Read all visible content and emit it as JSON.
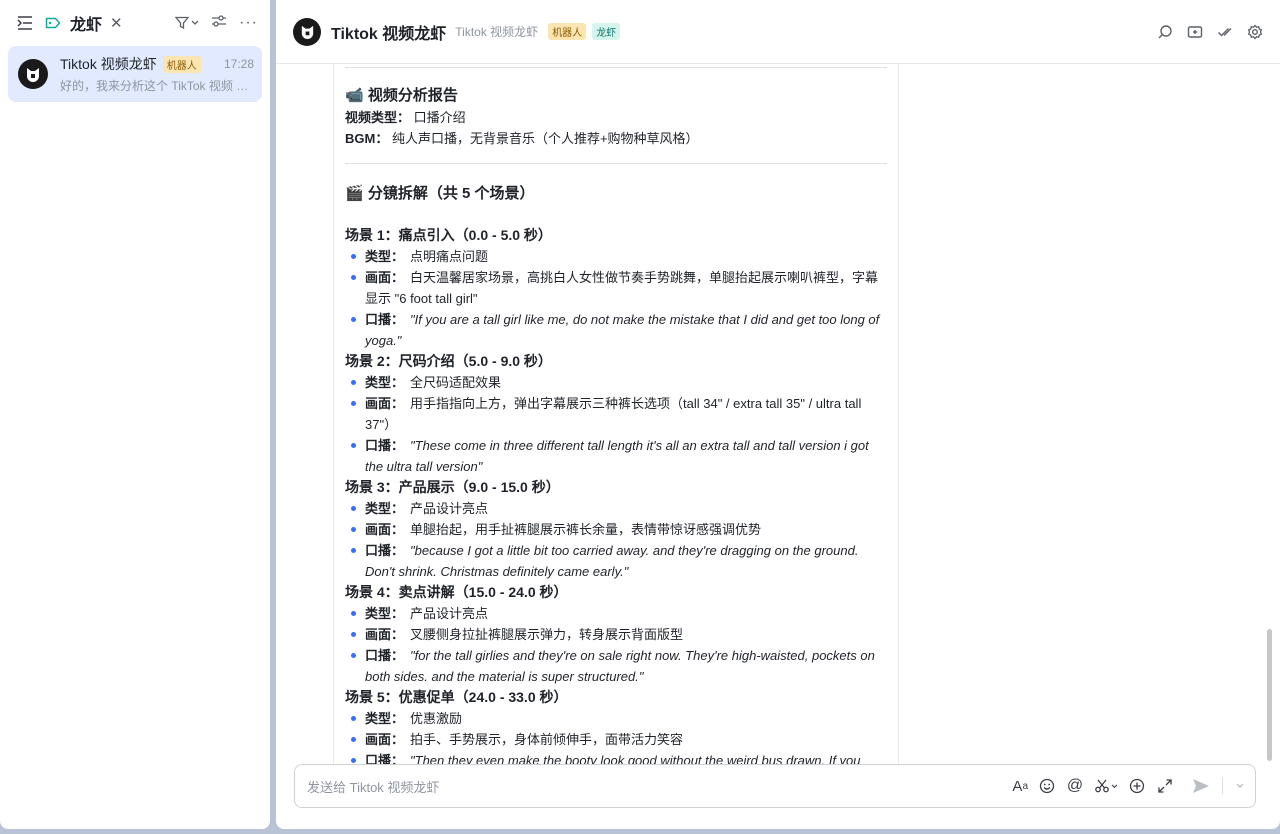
{
  "sidebar": {
    "title": "龙虾",
    "conversation": {
      "name": "Tiktok 视频龙虾",
      "badge": "机器人",
      "time": "17:28",
      "preview": "好的，我来分析这个 TikTok 视频 🎬 ..."
    }
  },
  "header": {
    "title": "Tiktok 视频龙虾",
    "subtitle": "Tiktok 视频龙虾",
    "badge_bot": "机器人",
    "badge_ext": "龙虾"
  },
  "report": {
    "heading": "📹 视频分析报告",
    "type_label": "视频类型：",
    "type_value": "口播介绍",
    "bgm_label": "BGM：",
    "bgm_value": "纯人声口播，无背景音乐（个人推荐+购物种草风格）",
    "scenes_heading": "🎬 分镜拆解（共 5 个场景）"
  },
  "labels": {
    "type": "类型：",
    "visual": "画面：",
    "speech": "口播："
  },
  "scenes": [
    {
      "title": "场景 1：痛点引入（0.0 - 5.0 秒）",
      "type": "点明痛点问题",
      "visual": "白天温馨居家场景，高挑白人女性做节奏手势跳舞，单腿抬起展示喇叭裤型，字幕显示 \"6 foot tall girl\"",
      "speech": "\"If you are a tall girl like me, do not make the mistake that I did and get too long of yoga.\""
    },
    {
      "title": "场景 2：尺码介绍（5.0 - 9.0 秒）",
      "type": "全尺码适配效果",
      "visual": "用手指指向上方，弹出字幕展示三种裤长选项（tall 34\" / extra tall 35\" / ultra tall 37\"）",
      "speech": "\"These come in three different tall length it's all an extra tall and tall version i got the ultra tall version\""
    },
    {
      "title": "场景 3：产品展示（9.0 - 15.0 秒）",
      "type": "产品设计亮点",
      "visual": "单腿抬起，用手扯裤腿展示裤长余量，表情带惊讶感强调优势",
      "speech": "\"because I got a little bit too carried away. and they're dragging on the ground. Don't shrink. Christmas definitely came early.\""
    },
    {
      "title": "场景 4：卖点讲解（15.0 - 24.0 秒）",
      "type": "产品设计亮点",
      "visual": "叉腰侧身拉扯裤腿展示弹力，转身展示背面版型",
      "speech": "\"for the tall girlies and they're on sale right now. They're high-waisted, pockets on both sides. and the material is super structured.\""
    },
    {
      "title": "场景 5：优惠促单（24.0 - 33.0 秒）",
      "type": "优惠激励",
      "visual": "拍手、手势展示，身体前倾伸手，面带活力笑容",
      "speech": "\"Then they even make the booty look good without the weird bus drawn. If you"
    }
  ],
  "composer": {
    "placeholder": "发送给 Tiktok 视频龙虾"
  }
}
